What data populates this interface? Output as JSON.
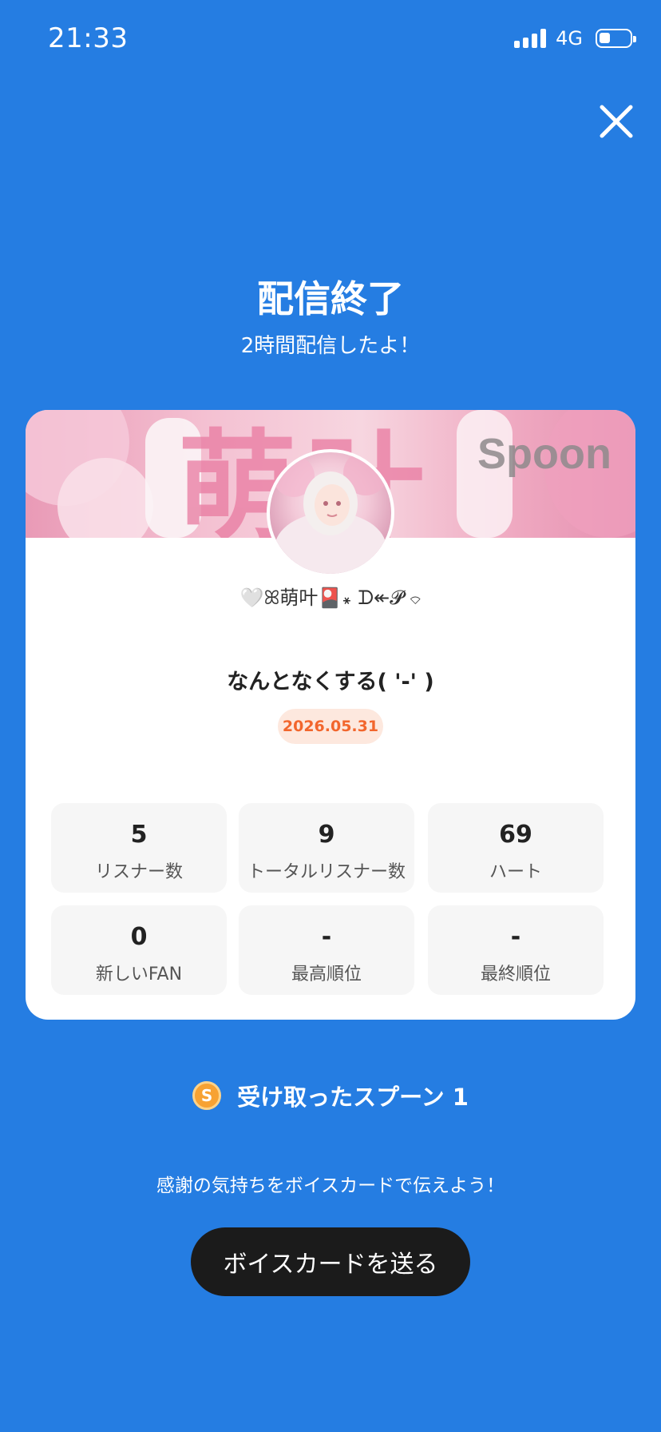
{
  "status_bar": {
    "time": "21:33",
    "network": "4G",
    "battery_level": 0.35,
    "icons": [
      "signal-icon",
      "battery-icon"
    ]
  },
  "close_icon": "close-icon",
  "header": {
    "title": "配信終了",
    "subtitle": "2時間配信したよ！"
  },
  "card": {
    "banner_text": "萌叶",
    "banner_brand": "Spoon",
    "nickname": "🤍ꕤ萌叶🎴꘎ ᗪ↞𝓟 ⌔",
    "live_title": "なんとなくする( '-' )",
    "date": "2026.05.31",
    "stats": [
      {
        "value": "5",
        "label": "リスナー数"
      },
      {
        "value": "9",
        "label": "トータルリスナー数"
      },
      {
        "value": "69",
        "label": "ハート"
      },
      {
        "value": "0",
        "label": "新しいFAN"
      },
      {
        "value": "-",
        "label": "最高順位"
      },
      {
        "value": "-",
        "label": "最終順位"
      }
    ]
  },
  "spoons": {
    "coin_symbol": "S",
    "text": "受け取ったスプーン  1"
  },
  "thanks_text": "感謝の気持ちをボイスカードで伝えよう！",
  "voice_card_button": "ボイスカードを送る",
  "colors": {
    "background": "#257de2",
    "date_badge_text": "#f2662d",
    "date_badge_bg": "#fde8de",
    "button_bg": "#1b1b1b",
    "coin": "#f7a233"
  }
}
